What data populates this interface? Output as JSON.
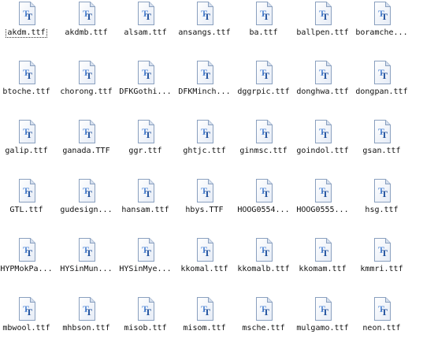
{
  "files": [
    {
      "name": "akdm.ttf",
      "icon": "truetype-font-file-icon",
      "selected": true
    },
    {
      "name": "akdmb.ttf",
      "icon": "truetype-font-file-icon"
    },
    {
      "name": "alsam.ttf",
      "icon": "truetype-font-file-icon"
    },
    {
      "name": "ansangs.ttf",
      "icon": "truetype-font-file-icon"
    },
    {
      "name": "ba.ttf",
      "icon": "truetype-font-file-icon"
    },
    {
      "name": "ballpen.ttf",
      "icon": "truetype-font-file-icon"
    },
    {
      "name": "boramche...",
      "icon": "truetype-font-file-icon"
    },
    {
      "name": "btoche.ttf",
      "icon": "truetype-font-file-icon"
    },
    {
      "name": "chorong.ttf",
      "icon": "truetype-font-file-icon"
    },
    {
      "name": "DFKGothi...",
      "icon": "truetype-font-file-icon"
    },
    {
      "name": "DFKMinch...",
      "icon": "truetype-font-file-icon"
    },
    {
      "name": "dggrpic.ttf",
      "icon": "truetype-font-file-icon"
    },
    {
      "name": "donghwa.ttf",
      "icon": "truetype-font-file-icon"
    },
    {
      "name": "dongpan.ttf",
      "icon": "truetype-font-file-icon"
    },
    {
      "name": "galip.ttf",
      "icon": "truetype-font-file-icon"
    },
    {
      "name": "ganada.TTF",
      "icon": "truetype-font-file-icon"
    },
    {
      "name": "ggr.ttf",
      "icon": "truetype-font-file-icon"
    },
    {
      "name": "ghtjc.ttf",
      "icon": "truetype-font-file-icon"
    },
    {
      "name": "ginmsc.ttf",
      "icon": "truetype-font-file-icon"
    },
    {
      "name": "goindol.ttf",
      "icon": "truetype-font-file-icon"
    },
    {
      "name": "gsan.ttf",
      "icon": "truetype-font-file-icon"
    },
    {
      "name": "GTL.ttf",
      "icon": "truetype-font-file-icon"
    },
    {
      "name": "gudesign...",
      "icon": "truetype-font-file-icon"
    },
    {
      "name": "hansam.ttf",
      "icon": "truetype-font-file-icon"
    },
    {
      "name": "hbys.TTF",
      "icon": "truetype-font-file-icon"
    },
    {
      "name": "HOOG0554...",
      "icon": "truetype-font-file-icon"
    },
    {
      "name": "HOOG0555...",
      "icon": "truetype-font-file-icon"
    },
    {
      "name": "hsg.ttf",
      "icon": "truetype-font-file-icon"
    },
    {
      "name": "HYPMokPa...",
      "icon": "truetype-font-file-icon"
    },
    {
      "name": "HYSinMun...",
      "icon": "truetype-font-file-icon"
    },
    {
      "name": "HYSinMye...",
      "icon": "truetype-font-file-icon"
    },
    {
      "name": "kkomal.ttf",
      "icon": "truetype-font-file-icon"
    },
    {
      "name": "kkomalb.ttf",
      "icon": "truetype-font-file-icon"
    },
    {
      "name": "kkomam.ttf",
      "icon": "truetype-font-file-icon"
    },
    {
      "name": "kmmri.ttf",
      "icon": "truetype-font-file-icon"
    },
    {
      "name": "mbwool.ttf",
      "icon": "truetype-font-file-icon"
    },
    {
      "name": "mhbson.ttf",
      "icon": "truetype-font-file-icon"
    },
    {
      "name": "misob.ttf",
      "icon": "truetype-font-file-icon"
    },
    {
      "name": "misom.ttf",
      "icon": "truetype-font-file-icon"
    },
    {
      "name": "msche.ttf",
      "icon": "truetype-font-file-icon"
    },
    {
      "name": "mulgamo.ttf",
      "icon": "truetype-font-file-icon"
    },
    {
      "name": "neon.ttf",
      "icon": "truetype-font-file-icon"
    }
  ],
  "colors": {
    "icon_t_dark": "#1e4f9c",
    "icon_t_light": "#5d8fd8",
    "page_fold": "#d5dfee",
    "page_border": "#8aa0bf"
  }
}
